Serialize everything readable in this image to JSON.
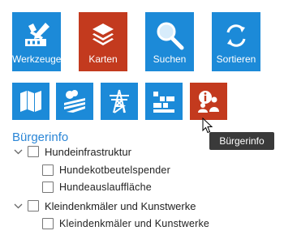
{
  "toolbar_top": [
    {
      "label": "Werkzeuge",
      "icon": "tools-icon",
      "color": "#1c8ad8"
    },
    {
      "label": "Karten",
      "icon": "layers-icon",
      "color": "#c33a1e"
    },
    {
      "label": "Suchen",
      "icon": "search-icon",
      "color": "#1c8ad8"
    },
    {
      "label": "Sortieren",
      "icon": "sort-icon",
      "color": "#1c8ad8"
    }
  ],
  "toolbar_small": [
    {
      "icon": "map-fold-icon",
      "active": false
    },
    {
      "icon": "landuse-icon",
      "active": false
    },
    {
      "icon": "power-tower-icon",
      "active": false
    },
    {
      "icon": "building-blocks-icon",
      "active": false
    },
    {
      "icon": "citizen-info-icon",
      "active": true
    }
  ],
  "section_title": "Bürgerinfo",
  "tree": {
    "group1": {
      "label": "Hundeinfrastruktur",
      "children": [
        "Hundekotbeutelspender",
        "Hundeauslauffläche"
      ]
    },
    "group2": {
      "label": "Kleindenkmäler und Kunstwerke",
      "children": [
        "Kleindenkmäler und Kunstwerke"
      ]
    }
  },
  "tooltip": "Bürgerinfo",
  "colors": {
    "accent": "#1c8ad8",
    "active": "#c33a1e",
    "title": "#2b86d6"
  }
}
